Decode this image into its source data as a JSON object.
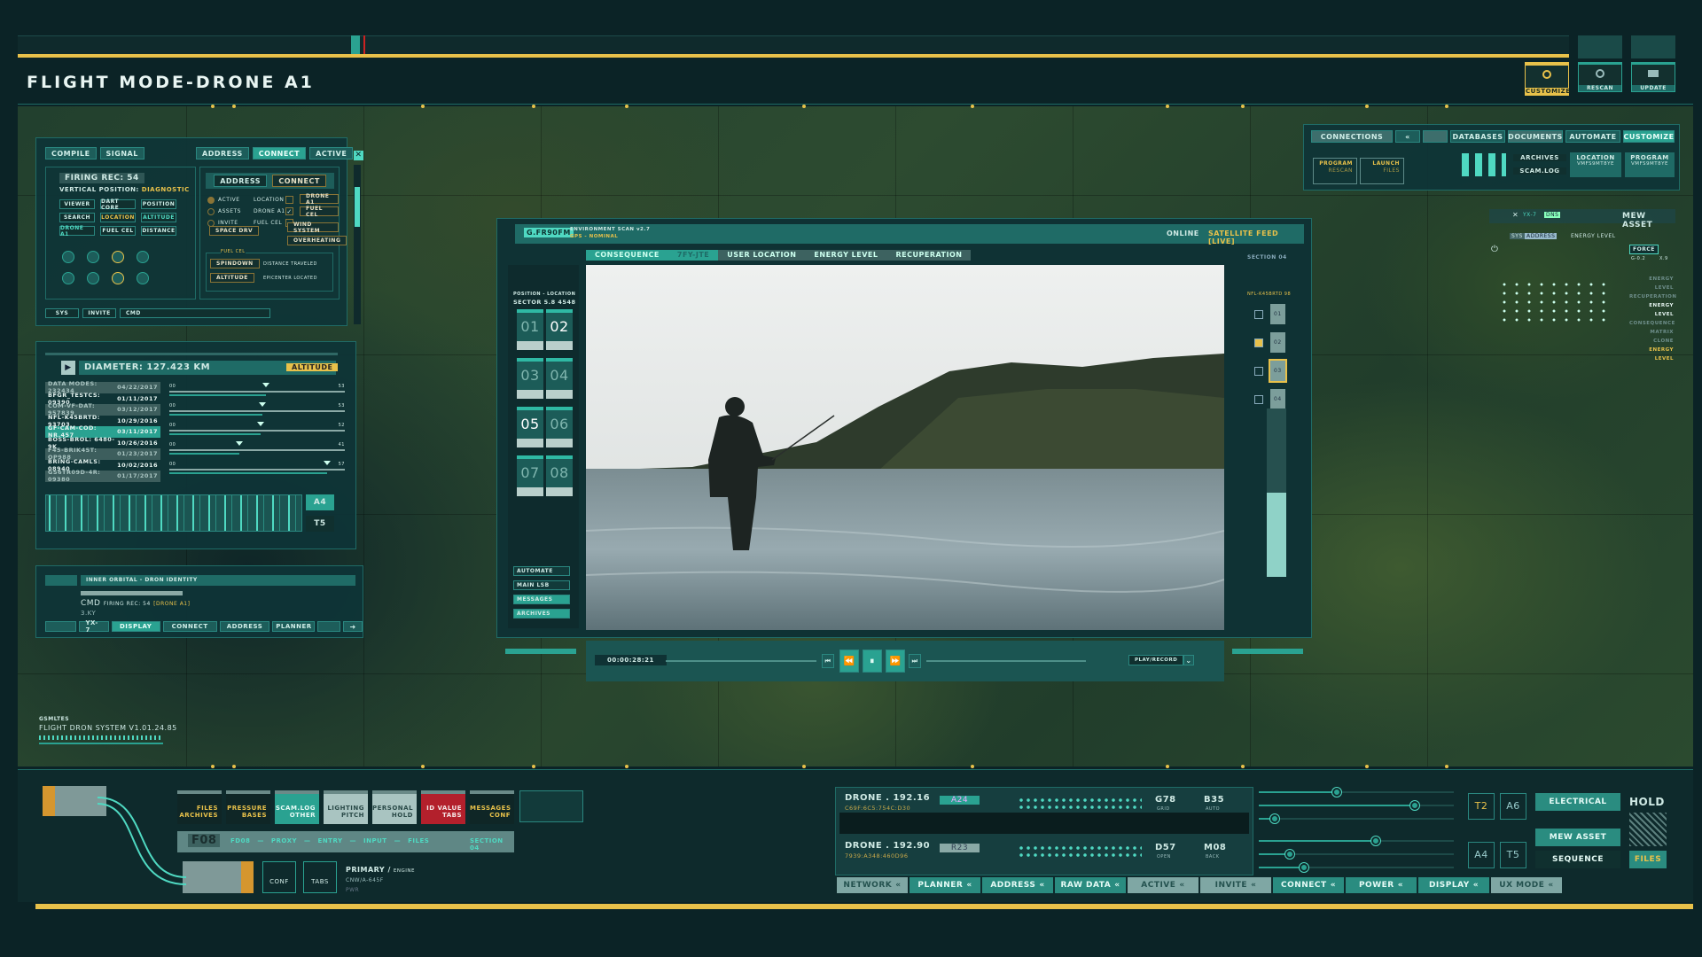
{
  "header": {
    "title": "FLIGHT MODE-DRONE A1",
    "actions": [
      {
        "label": "CUSTOMIZE",
        "icon": "settings-icon"
      },
      {
        "label": "RESCAN",
        "icon": "rescan-icon"
      },
      {
        "label": "UPDATE",
        "icon": "update-icon"
      }
    ]
  },
  "colors": {
    "accent": "#2aa291",
    "gold": "#e8c14a",
    "alert": "#b3202c",
    "bg": "#0b2326"
  },
  "control_panel": {
    "tabs": [
      "COMPILE",
      "SIGNAL",
      "ADDRESS",
      "CONNECT",
      "ACTIVE"
    ],
    "firing_rec": "FIRING REC: 54",
    "vertical_label": "VERTICAL POSITION:",
    "vertical_value": "DIAGNOSTIC",
    "grid_buttons": [
      "VIEWER",
      "DART CORE",
      "POSITION",
      "SEARCH",
      "LOCATION",
      "ALTITUDE",
      "DRONE A1",
      "FUEL CEL",
      "DISTANCE"
    ],
    "sub_tabs": [
      "ADDRESS",
      "CONNECT"
    ],
    "radios": [
      {
        "label": "ACTIVE",
        "checked": true
      },
      {
        "label": "ASSETS",
        "checked": false
      },
      {
        "label": "INVITE",
        "checked": false
      }
    ],
    "checks": [
      {
        "label": "LOCATION",
        "checked": false
      },
      {
        "label": "DRONE A1",
        "checked": true
      },
      {
        "label": "FUEL CEL",
        "checked": false
      }
    ],
    "side_buttons": [
      "DRONE A1",
      "FUEL CEL"
    ],
    "space_drv": "SPACE DRV",
    "wind": "WIND SYSTEM",
    "overheat": "OVERHEATING",
    "fuel_group": "FUEL CEL",
    "spindown": "SPINDOWN",
    "altitude": "ALTITUDE",
    "distance": "DISTANCE TRAVELED",
    "epicenter": "EPICENTER LOCATED",
    "footer": [
      "SYS",
      "INVITE",
      "CMD"
    ]
  },
  "data_panel": {
    "diameter": "DIAMETER: 127.423 KM",
    "badge": "ALTITUDE",
    "rows": [
      {
        "name": "DATA MODES: 232434",
        "date": "04/22/2017"
      },
      {
        "name": "BFGR_TESTCS: 09390",
        "date": "01/11/2017"
      },
      {
        "name": "COM-VF-DAT: 957839",
        "date": "03/12/2017"
      },
      {
        "name": "NFL-K45BRTD: 93703",
        "date": "10/29/2016"
      },
      {
        "name": "GF-CAM-COD: NR.457",
        "date": "03/11/2017"
      },
      {
        "name": "BOSS-BROL: 6480-9K",
        "date": "10/26/2016"
      },
      {
        "name": "F45-BRIK45T: OP988",
        "date": "01/23/2017"
      },
      {
        "name": "BRING-CAMLS: 08940",
        "date": "10/02/2016"
      },
      {
        "name": "GS6TR09D-4R: 09380",
        "date": "01/17/2017"
      }
    ],
    "sliders": [
      {
        "min": "00",
        "max": "53",
        "value": 0.55
      },
      {
        "min": "00",
        "max": "53",
        "value": 0.53
      },
      {
        "min": "00",
        "max": "52",
        "value": 0.52
      },
      {
        "min": "00",
        "max": "41",
        "value": 0.4
      },
      {
        "min": "00",
        "max": "57",
        "value": 0.9
      }
    ],
    "codes": [
      "A4",
      "T5"
    ]
  },
  "identity_panel": {
    "title": "INNER ORBITAL - DRON IDENTITY",
    "cmd": "CMD",
    "rec": "FIRING REC: 54",
    "tag": "[DRONE A1]",
    "sub": "3.KY",
    "buttons": [
      "YX-7",
      "DISPLAY",
      "CONNECT",
      "ADDRESS",
      "PLANNER"
    ]
  },
  "version": {
    "label": "GSMLTES",
    "name": "FLIGHT DRON SYSTEM V1.01.24.85"
  },
  "video": {
    "code": "G.FR90FM",
    "scan": "ENVIRONMENT SCAN v2.7",
    "gps": "GPS - NOMINAL",
    "status": "ONLINE",
    "feed": "SATELLITE FEED [LIVE]",
    "tabs": [
      "CONSEQUENCE",
      "7FY-JTE",
      "USER LOCATION",
      "ENERGY LEVEL",
      "RECUPERATION"
    ],
    "position_label": "POSITION - LOCATION",
    "sector": "SECTOR 5.8 4548",
    "slots": [
      "01",
      "02",
      "03",
      "04",
      "05",
      "06",
      "07",
      "08"
    ],
    "side_menu": [
      "AUTOMATE",
      "MAIN LSB",
      "MESSAGES",
      "ARCHIVES"
    ],
    "section": "SECTION 04",
    "section_code": "NFL-K45BRTD 98",
    "channels": [
      "01",
      "02",
      "03",
      "04"
    ],
    "timecode": "00:00:28:21",
    "mode": "PLAY/RECORD"
  },
  "top_right": {
    "tabs": [
      "CONNECTIONS",
      "DATABASES",
      "DOCUMENTS",
      "AUTOMATE",
      "CUSTOMIZE"
    ],
    "program": {
      "title": "PROGRAM",
      "sub": "RESCAN"
    },
    "launch": {
      "title": "LAUNCH",
      "sub": "FILES"
    },
    "archives": "ARCHIVES",
    "scamlog": "SCAM.LOG",
    "location": {
      "title": "LOCATION",
      "sub": "VMFS9MT8YE"
    },
    "program2": {
      "title": "PROGRAM",
      "sub": "VMFS9MT8YE"
    }
  },
  "asset_panel": {
    "id": "YX-7",
    "dns": "DNS",
    "title": "MEW ASSET",
    "sys": "SYS",
    "address": "ADDRESS",
    "energy": "ENERGY LEVEL",
    "force": "FORCE",
    "force_val": "G-0.2",
    "x_val": "X.9",
    "legend": [
      "ENERGY LEVEL",
      "RECUPERATION",
      "ENERGY LEVEL",
      "CONSEQUENCE",
      "MATRIX CLONE",
      "ENERGY LEVEL"
    ]
  },
  "bottom": {
    "tiles": [
      {
        "l1": "FILES",
        "l2": "ARCHIVES"
      },
      {
        "l1": "PRESSURE",
        "l2": "BASES"
      },
      {
        "l1": "SCAM.LOG",
        "l2": "OTHER"
      },
      {
        "l1": "LIGHTING",
        "l2": "PITCH"
      },
      {
        "l1": "PERSONAL",
        "l2": "HOLD"
      },
      {
        "l1": "ID VALUE",
        "l2": "TABS"
      },
      {
        "l1": "MESSAGES",
        "l2": "CONF"
      }
    ],
    "code": "F08",
    "path": [
      "FD08",
      "PROXY",
      "ENTRY",
      "INPUT",
      "FILES"
    ],
    "section": "SECTION 04",
    "conf": "CONF",
    "tabs": "TABS",
    "primary": "PRIMARY /",
    "engine": "ENGINE",
    "model": "CNW/A-645F",
    "pwr": "PWR",
    "drones": [
      {
        "name": "DRONE . 192.16",
        "addr": "C69F:6C5:754C:D30",
        "code": "A24",
        "v1": "G78",
        "l1": "GRID",
        "v2": "B35",
        "l2": "AUTO"
      },
      {
        "name": "DRONE . 192.90",
        "addr": "7939:A348:460D96",
        "code": "R23",
        "v1": "D57",
        "l1": "OPEN",
        "v2": "M08",
        "l2": "BACK"
      }
    ],
    "sliders": [
      0.4,
      0.8,
      0.08,
      0.6,
      0.16,
      0.23
    ],
    "codes": [
      "T2",
      "A6",
      "A4",
      "T5"
    ],
    "electrical": "ELECTRICAL",
    "mew": "MEW ASSET",
    "sequence": "SEQUENCE",
    "hold": "HOLD",
    "files": "FILES",
    "nav": [
      "NETWORK",
      "PLANNER",
      "ADDRESS",
      "RAW DATA",
      "ACTIVE",
      "INVITE",
      "CONNECT",
      "POWER",
      "DISPLAY",
      "UX MODE"
    ]
  }
}
